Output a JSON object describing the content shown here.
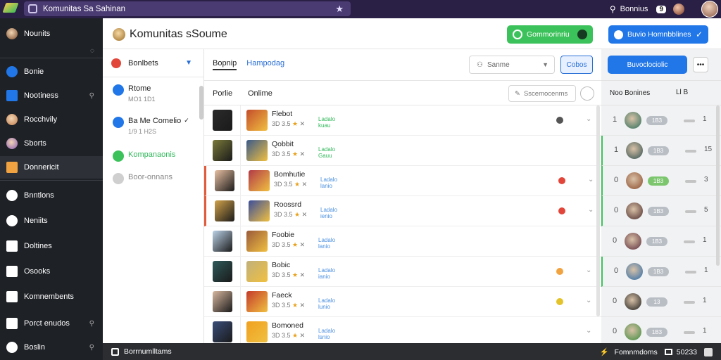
{
  "browser": {
    "tab_title": "Komunitas Sa Sahinan"
  },
  "topbar": {
    "account_label": "Bonnius",
    "badge_count": "9"
  },
  "sidebar": {
    "header_label": "Nounits",
    "items": [
      {
        "label": "Bonie",
        "icon": "pin-icon",
        "color": "#2177e8"
      },
      {
        "label": "Nootiness",
        "icon": "folder-icon",
        "color": "#2177e8"
      },
      {
        "label": "Rocchvily",
        "icon": "avatar-icon",
        "color": "#c27b4a"
      },
      {
        "label": "Sborts",
        "icon": "avatar-icon",
        "color": "#8a5ab5"
      },
      {
        "label": "Donnericit",
        "icon": "calendar-icon",
        "color": "#f2a341"
      },
      {
        "label": "Bnntlons",
        "icon": "heart-icon",
        "color": "#ffffff"
      },
      {
        "label": "Neniits",
        "icon": "x-icon",
        "color": "#ffffff"
      },
      {
        "label": "Doltines",
        "icon": "chart-icon",
        "color": "#ffffff"
      },
      {
        "label": "Osooks",
        "icon": "clipboard-icon",
        "color": "#ffffff"
      },
      {
        "label": "Komnembents",
        "icon": "grid-icon",
        "color": "#ffffff"
      },
      {
        "label": "Porct enudos",
        "icon": "chart-icon",
        "color": "#ffffff"
      },
      {
        "label": "Boslin",
        "icon": "plus-icon",
        "color": "#ffffff"
      }
    ]
  },
  "header": {
    "title": "Komunitas sSoume",
    "green_button_label": "Gommorinriu",
    "blue_button_label": "Buvio Homnbblines"
  },
  "filter_panel": {
    "dropdown_label": "Bonlbets",
    "items": [
      {
        "label": "Rtome",
        "sub": "MO1 1D1",
        "icon_color": "#2177e8"
      },
      {
        "label": "Ba Me Comelio",
        "sub": "1/9 1 H2S",
        "icon_color": "#2177e8",
        "check": "✓"
      },
      {
        "label": "Kompanaonis",
        "sub": "",
        "icon_color": "#3cc25a",
        "green": true
      },
      {
        "label": "Boor-onnans",
        "sub": "",
        "icon_color": "#cfcfcf"
      }
    ]
  },
  "main": {
    "tabs": [
      "Bopnip",
      "Hampodag"
    ],
    "select_placeholder": "Sanme",
    "action_button": "Cobos",
    "col_1": "Porlie",
    "col_2": "Onlime",
    "search_placeholder": "Sscemocenms",
    "rows": [
      {
        "name": "Flebot",
        "meta": "3D 3.5",
        "tag1": "Ladalo",
        "tag2": "kuau",
        "dot": "#555555",
        "t1": "#2b2b2b",
        "t2": "#c44d2b"
      },
      {
        "name": "Qobbit",
        "meta": "3D 3.5",
        "tag1": "Ladalo",
        "tag2": "Gauu",
        "dot": "",
        "t1": "#7a7a3a",
        "t2": "#3a5a8a"
      },
      {
        "name": "Bomhutie",
        "meta": "3D 3.5",
        "tag1": "Ladalo",
        "tag2": "lanio",
        "dot": "#e2463b",
        "t1": "#e8c0a2",
        "t2": "#b23a48"
      },
      {
        "name": "Roossrd",
        "meta": "3D 3.5",
        "tag1": "Ladalo",
        "tag2": "ienio",
        "dot": "#e2463b",
        "t1": "#d1a34a",
        "t2": "#3b4e9a"
      },
      {
        "name": "Foobie",
        "meta": "3D 3.5",
        "tag1": "Ladalo",
        "tag2": "lanio",
        "dot": "",
        "t1": "#bcd2e8",
        "t2": "#9a5a3a"
      },
      {
        "name": "Bobic",
        "meta": "3D 3.5",
        "tag1": "Ladalo",
        "tag2": "ianio",
        "dot": "#f2a341",
        "t1": "#2f5a5a",
        "t2": "#c0b07a"
      },
      {
        "name": "Faeck",
        "meta": "3D 3.5",
        "tag1": "Ladalo",
        "tag2": "lunio",
        "dot": "#e3c22a",
        "t1": "#d8b8a0",
        "t2": "#c43a2b"
      },
      {
        "name": "Bomoned",
        "meta": "3D 3.5",
        "tag1": "Ladalo",
        "tag2": "lsnio",
        "dot": "",
        "t1": "#3a4e7a",
        "t2": "#f0a020"
      }
    ]
  },
  "right_panel": {
    "button_label": "Buvoclociolic",
    "col_label": "Noo Bonines",
    "col_right": "Ll B",
    "rows": [
      {
        "rank": "1",
        "pill": "1B3",
        "num": "1",
        "pill_color": "#b9bec5",
        "av": "#2b6d5a"
      },
      {
        "rank": "1",
        "pill": "1B3",
        "num": "15",
        "pill_color": "#b9bec5",
        "av": "#2f4e4e"
      },
      {
        "rank": "0",
        "pill": "1B3",
        "num": "3",
        "pill_color": "#7cc66e",
        "av": "#8a4a2a"
      },
      {
        "rank": "0",
        "pill": "1B3",
        "num": "5",
        "pill_color": "#b9bec5",
        "av": "#4a2a2a"
      },
      {
        "rank": "0",
        "pill": "1B3",
        "num": "1",
        "pill_color": "#b9bec5",
        "av": "#5a2a3a"
      },
      {
        "rank": "0",
        "pill": "1B3",
        "num": "1",
        "pill_color": "#b9bec5",
        "av": "#2a6aa8"
      },
      {
        "rank": "0",
        "pill": "13",
        "num": "1",
        "pill_color": "#b9bec5",
        "av": "#1a1a1a"
      },
      {
        "rank": "0",
        "pill": "1B3",
        "num": "1",
        "pill_color": "#b9bec5",
        "av": "#3a8a3a"
      }
    ]
  },
  "bottombar": {
    "left_label": "Borrnumlltams",
    "right_label": "Fomnmdoms",
    "right_num": "50233"
  }
}
